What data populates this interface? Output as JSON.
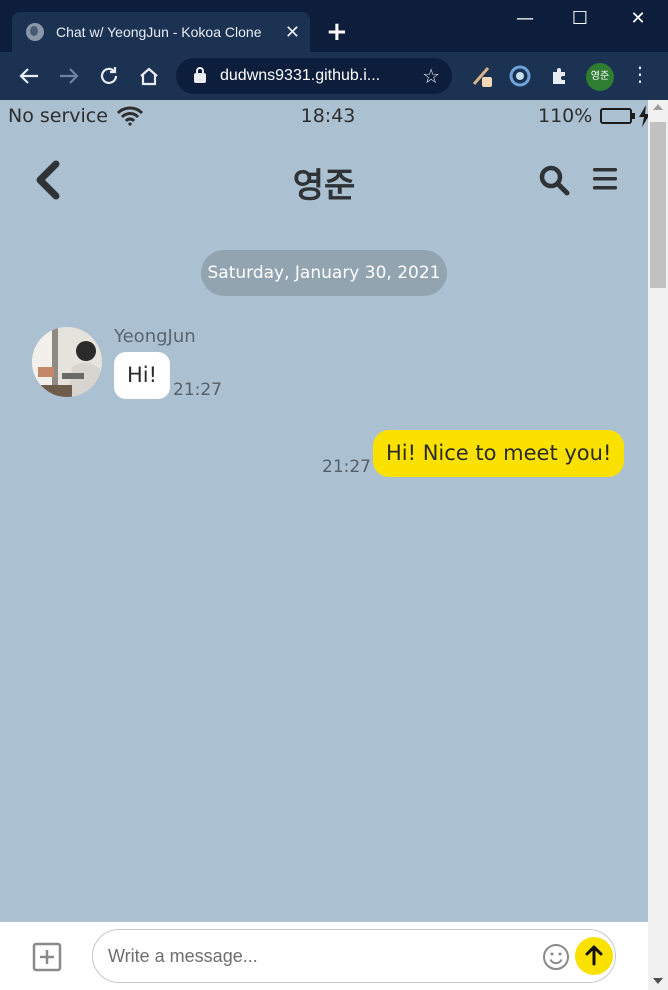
{
  "browser": {
    "tab_title": "Chat w/ YeongJun - Kokoa Clone",
    "tab_close": "✕",
    "new_tab": "+",
    "url": "dudwns9331.github.i...",
    "profile_label": "영준",
    "window_controls": {
      "minimize": "—",
      "maximize": "☐",
      "close": "✕"
    }
  },
  "statusbar": {
    "carrier": "No service",
    "time": "18:43",
    "battery": "110%"
  },
  "header": {
    "title": "영준"
  },
  "chat": {
    "date": "Saturday, January 30, 2021",
    "messages": [
      {
        "direction": "in",
        "sender": "YeongJun",
        "text": "Hi!",
        "time": "21:27"
      },
      {
        "direction": "out",
        "text": "Hi! Nice to meet you!",
        "time": "21:27"
      }
    ]
  },
  "composer": {
    "placeholder": "Write a message..."
  },
  "colors": {
    "chat_background": "#abc1d1",
    "outgoing_bubble": "#fae100",
    "incoming_bubble": "#ffffff",
    "browser_frame": "#0c1e3b"
  }
}
